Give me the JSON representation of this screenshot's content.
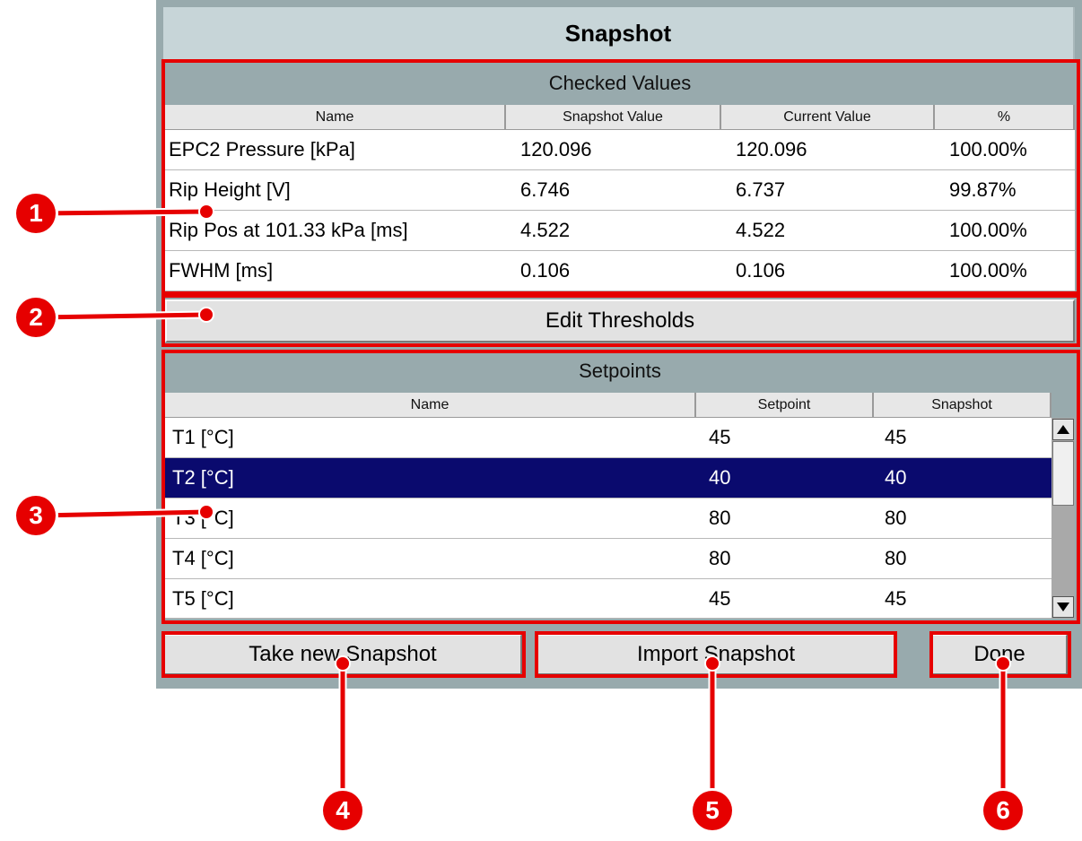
{
  "dialog": {
    "title": "Snapshot",
    "checked_values": {
      "heading": "Checked Values",
      "columns": [
        "Name",
        "Snapshot Value",
        "Current Value",
        "%"
      ],
      "rows": [
        [
          "EPC2 Pressure [kPa]",
          "120.096",
          "120.096",
          "100.00%"
        ],
        [
          "Rip Height [V]",
          "6.746",
          "6.737",
          "99.87%"
        ],
        [
          "Rip Pos at 101.33 kPa [ms]",
          "4.522",
          "4.522",
          "100.00%"
        ],
        [
          "FWHM [ms]",
          "0.106",
          "0.106",
          "100.00%"
        ]
      ]
    },
    "edit_thresholds_label": "Edit Thresholds",
    "setpoints": {
      "heading": "Setpoints",
      "columns": [
        "Name",
        "Setpoint",
        "Snapshot"
      ],
      "rows": [
        [
          "T1 [°C]",
          "45",
          "45"
        ],
        [
          "T2 [°C]",
          "40",
          "40"
        ],
        [
          "T3 [°C]",
          "80",
          "80"
        ],
        [
          "T4 [°C]",
          "80",
          "80"
        ],
        [
          "T5 [°C]",
          "45",
          "45"
        ]
      ],
      "selected_row": 1
    },
    "buttons": {
      "take_new": "Take new Snapshot",
      "import": "Import Snapshot",
      "done": "Done"
    }
  },
  "callouts": [
    "1",
    "2",
    "3",
    "4",
    "5",
    "6"
  ],
  "colors": {
    "annotation_red": "#e60000",
    "selection_blue": "#0a0a6e",
    "panel_gray": "#98aaad"
  },
  "icons": {
    "scroll_up": "triangle-up-icon",
    "scroll_down": "triangle-down-icon"
  }
}
